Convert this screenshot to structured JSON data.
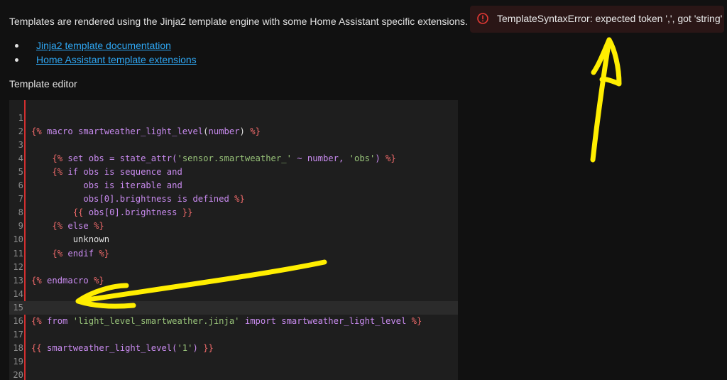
{
  "intro": "Templates are rendered using the Jinja2 template engine with some Home Assistant specific extensions.",
  "links": [
    {
      "label": "Jinja2 template documentation"
    },
    {
      "label": "Home Assistant template extensions"
    }
  ],
  "editor_label": "Template editor",
  "error": {
    "message": "TemplateSyntaxError: expected token ',', got 'string'",
    "icon": "alert-circle-icon"
  },
  "code_lines": [
    {
      "n": "1",
      "tokens": []
    },
    {
      "n": "2",
      "tokens": [
        {
          "c": "t-tag",
          "t": "{%"
        },
        {
          "c": "t-kw",
          "t": " macro "
        },
        {
          "c": "t-name",
          "t": "smartweather_light_level"
        },
        {
          "c": "t-var",
          "t": "("
        },
        {
          "c": "t-kw",
          "t": "number"
        },
        {
          "c": "t-var",
          "t": ")"
        },
        {
          "c": "t-tag",
          "t": " %}"
        }
      ]
    },
    {
      "n": "3",
      "tokens": []
    },
    {
      "n": "4",
      "tokens": [
        {
          "c": "t-var",
          "t": "    "
        },
        {
          "c": "t-tag",
          "t": "{%"
        },
        {
          "c": "t-kw",
          "t": " set obs = state_attr("
        },
        {
          "c": "t-str",
          "t": "'sensor.smartweather_'"
        },
        {
          "c": "t-kw",
          "t": " ~ number, "
        },
        {
          "c": "t-str",
          "t": "'obs'"
        },
        {
          "c": "t-kw",
          "t": ")"
        },
        {
          "c": "t-tag",
          "t": " %}"
        }
      ]
    },
    {
      "n": "5",
      "tokens": [
        {
          "c": "t-var",
          "t": "    "
        },
        {
          "c": "t-tag",
          "t": "{%"
        },
        {
          "c": "t-kw",
          "t": " if obs is sequence and"
        }
      ]
    },
    {
      "n": "6",
      "tokens": [
        {
          "c": "t-kw",
          "t": "          obs is iterable and"
        }
      ]
    },
    {
      "n": "7",
      "tokens": [
        {
          "c": "t-kw",
          "t": "          obs[0].brightness is defined"
        },
        {
          "c": "t-tag",
          "t": " %}"
        }
      ]
    },
    {
      "n": "8",
      "tokens": [
        {
          "c": "t-var",
          "t": "        "
        },
        {
          "c": "t-tag",
          "t": "{{"
        },
        {
          "c": "t-kw",
          "t": " obs[0].brightness"
        },
        {
          "c": "t-tag",
          "t": " }}"
        }
      ]
    },
    {
      "n": "9",
      "tokens": [
        {
          "c": "t-var",
          "t": "    "
        },
        {
          "c": "t-tag",
          "t": "{%"
        },
        {
          "c": "t-kw",
          "t": " else"
        },
        {
          "c": "t-tag",
          "t": " %}"
        }
      ]
    },
    {
      "n": "10",
      "tokens": [
        {
          "c": "t-var",
          "t": "        unknown"
        }
      ]
    },
    {
      "n": "11",
      "tokens": [
        {
          "c": "t-var",
          "t": "    "
        },
        {
          "c": "t-tag",
          "t": "{%"
        },
        {
          "c": "t-kw",
          "t": " endif"
        },
        {
          "c": "t-tag",
          "t": " %}"
        }
      ]
    },
    {
      "n": "12",
      "tokens": []
    },
    {
      "n": "13",
      "tokens": [
        {
          "c": "t-tag",
          "t": "{%"
        },
        {
          "c": "t-kw",
          "t": " endmacro"
        },
        {
          "c": "t-tag",
          "t": " %}"
        }
      ]
    },
    {
      "n": "14",
      "tokens": []
    },
    {
      "n": "15",
      "tokens": [],
      "active": true
    },
    {
      "n": "16",
      "tokens": [
        {
          "c": "t-tag",
          "t": "{%"
        },
        {
          "c": "t-kw",
          "t": " from "
        },
        {
          "c": "t-str",
          "t": "'light_level_smartweather.jinja'"
        },
        {
          "c": "t-kw",
          "t": " import smartweather_light_level"
        },
        {
          "c": "t-tag",
          "t": " %}"
        }
      ]
    },
    {
      "n": "17",
      "tokens": []
    },
    {
      "n": "18",
      "tokens": [
        {
          "c": "t-tag",
          "t": "{{"
        },
        {
          "c": "t-kw",
          "t": " smartweather_light_level("
        },
        {
          "c": "t-str",
          "t": "'1'"
        },
        {
          "c": "t-kw",
          "t": ")"
        },
        {
          "c": "t-tag",
          "t": " }}"
        }
      ]
    },
    {
      "n": "19",
      "tokens": []
    },
    {
      "n": "20",
      "tokens": []
    }
  ],
  "colors": {
    "accent_link": "#2fa7f3",
    "error_icon": "#e53935",
    "annotation": "#ffee00",
    "gutter_marker": "#d32f2f"
  }
}
